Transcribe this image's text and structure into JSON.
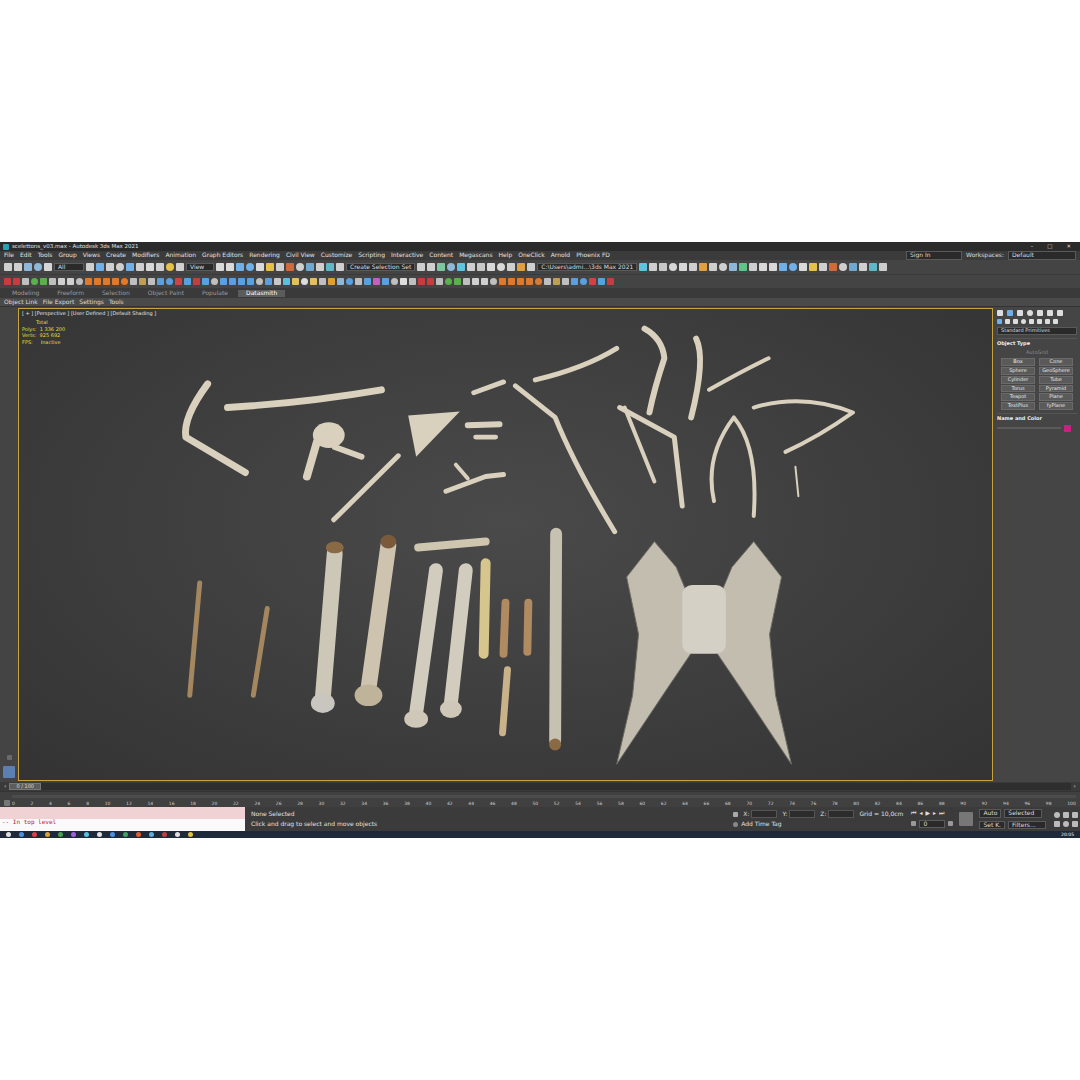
{
  "window": {
    "title": "scelettons_v03.max - Autodesk 3ds Max 2021",
    "controls": [
      "–",
      "□",
      "✕"
    ]
  },
  "menu": [
    "File",
    "Edit",
    "Tools",
    "Group",
    "Views",
    "Create",
    "Modifiers",
    "Animation",
    "Graph Editors",
    "Rendering",
    "Civil View",
    "Customize",
    "Scripting",
    "Interactive",
    "Content",
    "Megascans",
    "Help",
    "OneClick",
    "Arnold",
    "Phoenix FD"
  ],
  "account": {
    "sign_in": "Sign In",
    "workspaces_label": "Workspaces:",
    "workspace": "Default"
  },
  "main_toolbar": {
    "filter": "All",
    "coord_system": "View",
    "selection_set": "Create Selection Set",
    "project_path": "C:\\Users\\admi...\\3ds Max 2021"
  },
  "ribbon_tabs": [
    {
      "label": "Modeling",
      "selected": false
    },
    {
      "label": "Freeform",
      "selected": false
    },
    {
      "label": "Selection",
      "selected": false
    },
    {
      "label": "Object Paint",
      "selected": false
    },
    {
      "label": "Populate",
      "selected": false
    },
    {
      "label": "Datasmith",
      "selected": true
    }
  ],
  "ribbon_items": [
    "Object Link",
    "File Export",
    "Settings",
    "Tools"
  ],
  "viewport": {
    "label": "[ + ] [Perspective ] [User Defined ] [Default Shading ]",
    "total": "Total",
    "stats": [
      {
        "label": "Polys:",
        "value": "1 336 200"
      },
      {
        "label": "Verts:",
        "value": "925 692"
      }
    ],
    "fps_label": "FPS:",
    "fps": "Inactive"
  },
  "command_panel": {
    "category": "Standard Primitives",
    "object_type": "Object Type",
    "autogrid": {
      "label": "AutoGrid",
      "checked": false,
      "disabled": true
    },
    "buttons": [
      "Box",
      "Cone",
      "Sphere",
      "GeoSphere",
      "Cylinder",
      "Tube",
      "Torus",
      "Pyramid",
      "Teapot",
      "Plane",
      "TextPlus",
      "fyPlane"
    ],
    "name_color": "Name and Color",
    "object_color": "#c4237f"
  },
  "time_slider": {
    "label": "0 / 100",
    "level": 0
  },
  "track_bar": {
    "ticks": [
      "0",
      "2",
      "4",
      "6",
      "8",
      "10",
      "12",
      "14",
      "16",
      "18",
      "20",
      "22",
      "24",
      "26",
      "28",
      "30",
      "32",
      "34",
      "36",
      "38",
      "40",
      "42",
      "44",
      "46",
      "48",
      "50",
      "52",
      "54",
      "56",
      "58",
      "60",
      "62",
      "64",
      "66",
      "68",
      "70",
      "72",
      "74",
      "76",
      "78",
      "80",
      "82",
      "84",
      "86",
      "88",
      "90",
      "92",
      "94",
      "96",
      "98",
      "100"
    ]
  },
  "status": {
    "listener": "-- In top level",
    "selection": "None Selected",
    "prompt": "Click and drag to select and move objects",
    "coords": [
      {
        "label": "X:",
        "value": ""
      },
      {
        "label": "Y:",
        "value": ""
      },
      {
        "label": "Z:",
        "value": ""
      }
    ],
    "grid": "Grid = 10,0cm",
    "time_tag": "Add Time Tag",
    "key_mode": "Auto",
    "key_filter": "Selected",
    "set_key": "Set K.",
    "filters": "Filters...",
    "frame": "0"
  },
  "taskbar": {
    "clock": "20:05"
  }
}
